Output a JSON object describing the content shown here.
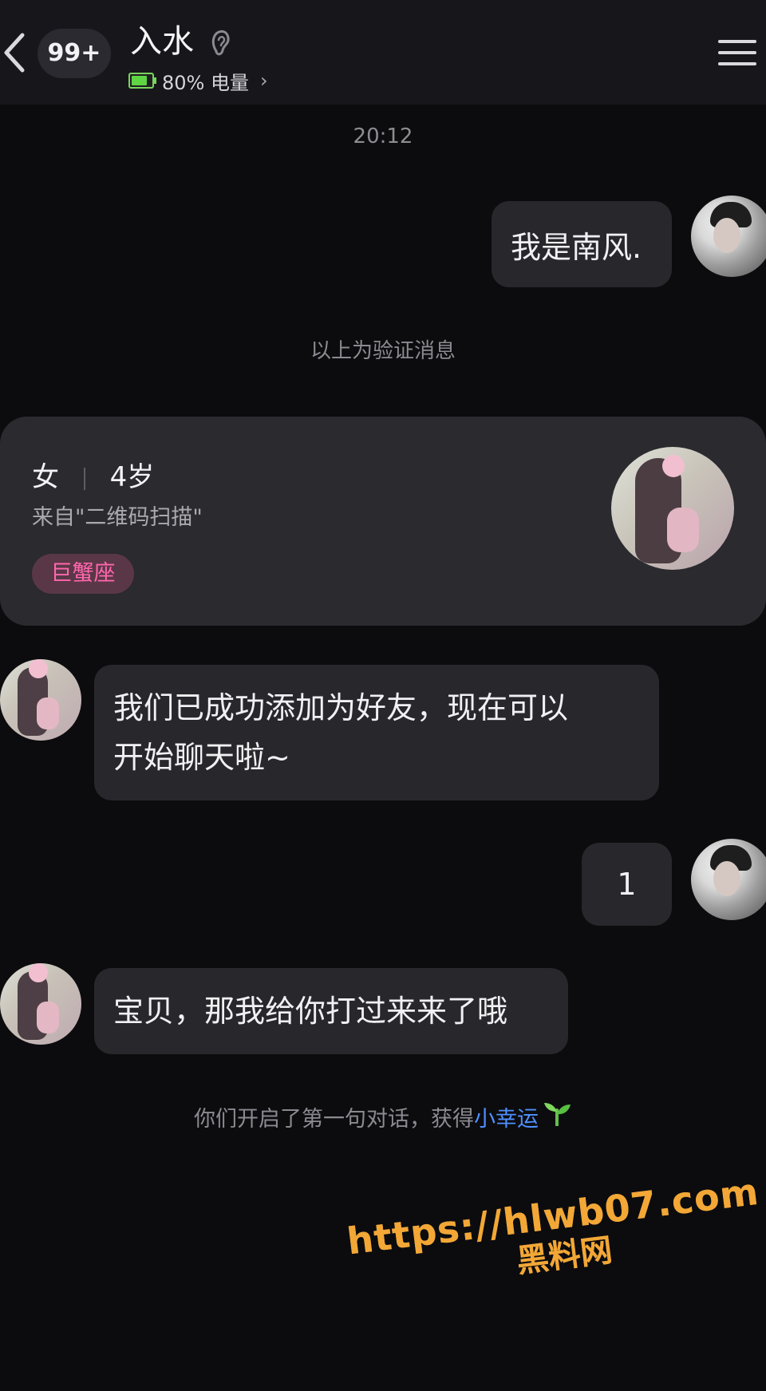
{
  "header": {
    "unread_count": "99+",
    "title": "入水",
    "battery_text": "80% 电量",
    "battery_level": 0.8
  },
  "chat": {
    "time": "20:12",
    "messages": [
      {
        "sender": "self",
        "text": "我是南风."
      },
      {
        "sender": "other",
        "text_line1": "我们已成功添加为好友，现在可以",
        "text_line2": "开始聊天啦~"
      },
      {
        "sender": "self",
        "text": "1"
      },
      {
        "sender": "other",
        "text": "宝贝，那我给你打过来来了哦"
      }
    ],
    "verification_note": "以上为验证消息",
    "footer_prefix": "你们开启了第一句对话，获得",
    "footer_highlight": "小幸运",
    "footer_icon": "seedling-icon"
  },
  "profile": {
    "gender": "女",
    "age": "4岁",
    "source": "来自\"二维码扫描\"",
    "tag": "巨蟹座"
  },
  "watermark": {
    "url": "https://hlwb07.com",
    "label": "黑料网"
  },
  "colors": {
    "background": "#0c0c0f",
    "header": "#17171b",
    "bubble": "#27272c",
    "tag_bg": "#5a3747",
    "tag_text": "#ff67ad",
    "link": "#4f91ff",
    "watermark": "#f2a736"
  }
}
